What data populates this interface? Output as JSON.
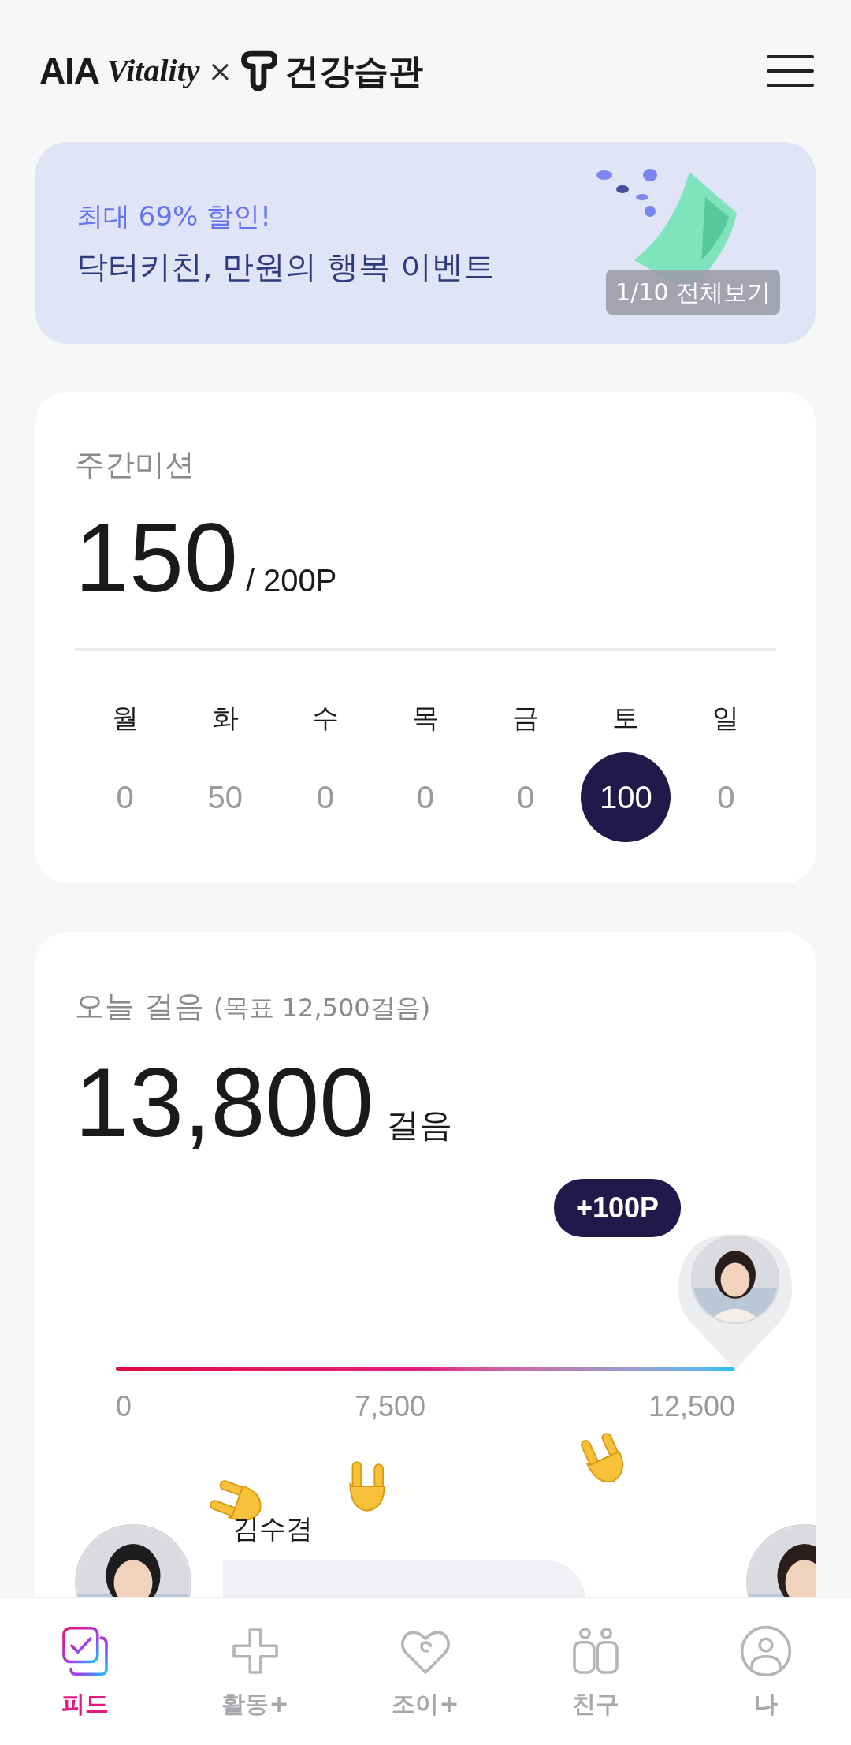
{
  "header": {
    "brand": "AIA",
    "brand_script": "Vitality",
    "separator": "×",
    "partner": "건강습관"
  },
  "banner": {
    "eyebrow": "최대 69% 할인!",
    "title": "닥터키친, 만원의 행복 이벤트",
    "pager": "1/10 전체보기"
  },
  "weekly_mission": {
    "title": "주간미션",
    "points": "150",
    "goal": "/ 200P",
    "days": [
      {
        "day": "월",
        "points": "0",
        "selected": false
      },
      {
        "day": "화",
        "points": "50",
        "selected": false
      },
      {
        "day": "수",
        "points": "0",
        "selected": false
      },
      {
        "day": "목",
        "points": "0",
        "selected": false
      },
      {
        "day": "금",
        "points": "0",
        "selected": false
      },
      {
        "day": "토",
        "points": "100",
        "selected": true
      },
      {
        "day": "일",
        "points": "0",
        "selected": false
      }
    ]
  },
  "steps": {
    "title": "오늘 걸음",
    "goal_note": "(목표 12,500걸음)",
    "count": "13,800",
    "unit": "걸음",
    "reward": "+100P",
    "level": 1,
    "ticks": [
      "0",
      "7,500",
      "12,500"
    ],
    "friend": {
      "name": "김수겸"
    }
  },
  "bottom_nav": [
    {
      "label": "피드",
      "selected": true
    },
    {
      "label": "활동+",
      "selected": false
    },
    {
      "label": "조이+",
      "selected": false
    },
    {
      "label": "친구",
      "selected": false
    },
    {
      "label": "나",
      "selected": false
    }
  ]
}
